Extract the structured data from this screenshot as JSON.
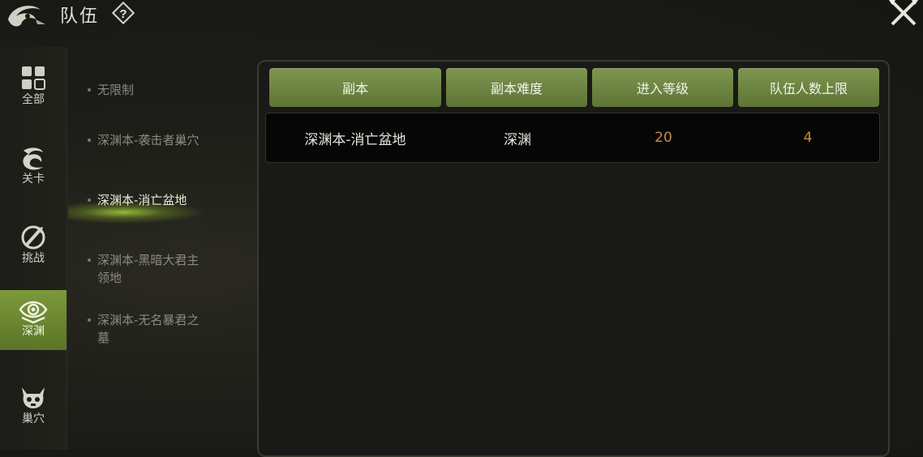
{
  "header": {
    "title": "队伍",
    "help_icon": "question-mark-icon",
    "logo_icon": "dragon-emblem-icon",
    "close_icon": "crossed-swords-close-icon"
  },
  "sidebar": {
    "items": [
      {
        "label": "全部",
        "icon": "grid-icon",
        "active": false
      },
      {
        "label": "关卡",
        "icon": "swirl-icon",
        "active": false
      },
      {
        "label": "挑战",
        "icon": "challenge-icon",
        "active": false
      },
      {
        "label": "深渊",
        "icon": "eye-icon",
        "active": true
      },
      {
        "label": "巢穴",
        "icon": "demon-skull-icon",
        "active": false
      }
    ]
  },
  "subnav": {
    "items": [
      {
        "label": "无限制",
        "active": false
      },
      {
        "label": "深渊本-袭击者巢穴",
        "active": false
      },
      {
        "label": "深渊本-消亡盆地",
        "active": true
      },
      {
        "label": "深渊本-黑暗大君主领地",
        "active": false
      },
      {
        "label": "深渊本-无名暴君之墓",
        "active": false
      }
    ]
  },
  "table": {
    "columns": [
      "副本",
      "副本难度",
      "进入等级",
      "队伍人数上限"
    ],
    "rows": [
      {
        "dungeon": "深渊本-消亡盆地",
        "difficulty": "深渊",
        "level": "20",
        "max_members": "4"
      }
    ]
  },
  "colors": {
    "accent_green": "#7e9650",
    "number_orange": "#c88a42"
  }
}
